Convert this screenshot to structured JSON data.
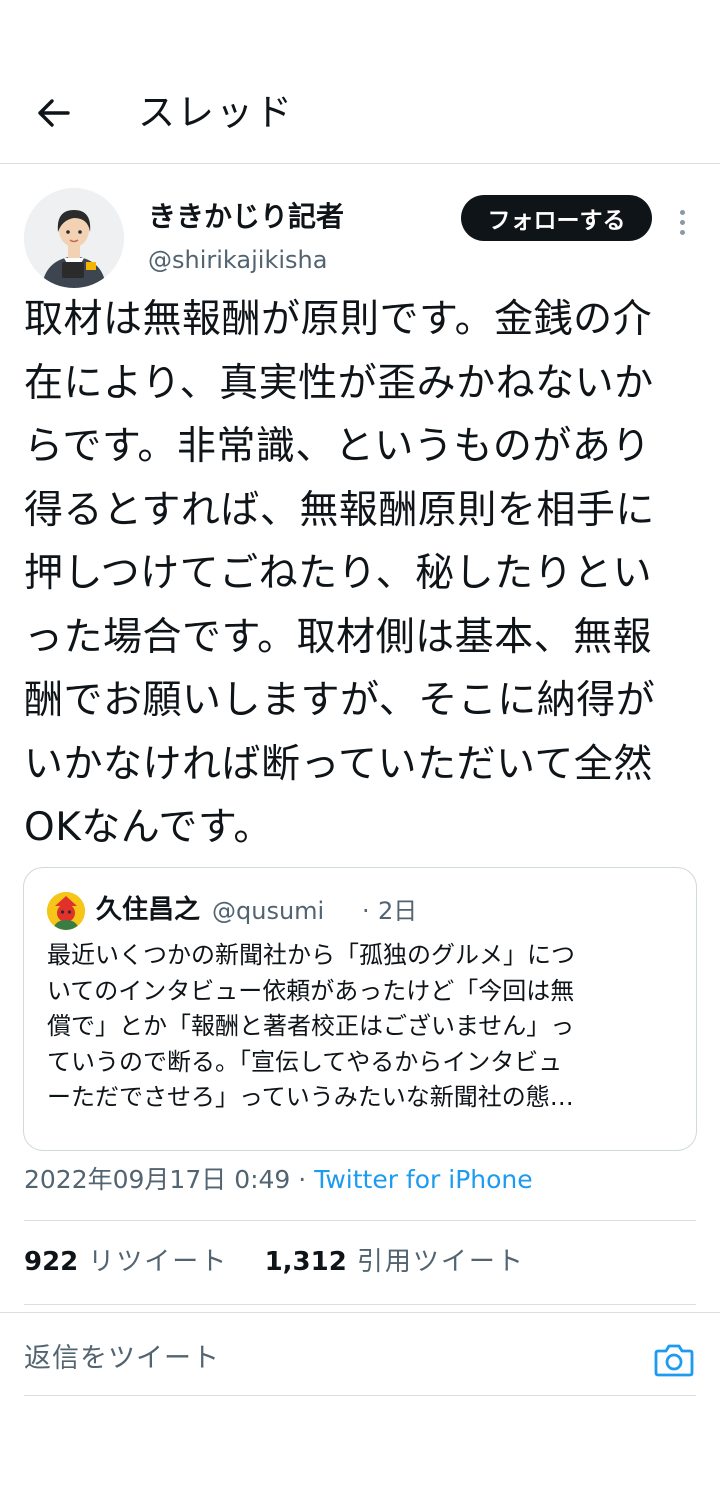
{
  "header": {
    "title": "スレッド",
    "back_icon": "arrow-left-icon"
  },
  "tweet": {
    "author": {
      "name": "ききかじり記者",
      "handle": "@shirikajikisha"
    },
    "follow_label": "フォローする",
    "more_icon": "more-vertical-icon",
    "text": "取材は無報酬が原則です。金銭の介\n在により、真実性が歪みかねないか\nらです。非常識、というものがあり\n得るとすれば、無報酬原則を相手に\n押しつけてごねたり、秘したりとい\nった場合です。取材側は基本、無報\n酬でお願いしますが、そこに納得が\nいかなければ断っていただいて全然\nOKなんです。",
    "quote": {
      "name": "久住昌之",
      "handle": "@qusumi",
      "separator": "·",
      "date": "2日",
      "text": "最近いくつかの新聞社から「孤独のグルメ」につ\nいてのインタビュー依頼があったけど「今回は無\n償で」とか「報酬と著者校正はございません」っ\nていうので断る。「宣伝してやるからインタビュ\nーただでさせろ」っていうみたいな新聞社の態…"
    },
    "timestamp": "2022年09月17日 0:49",
    "meta_separator": " · ",
    "source": "Twitter for iPhone",
    "stats": {
      "retweets_count": "922",
      "retweets_label": "リツイート",
      "quotes_count": "1,312",
      "quotes_label": "引用ツイート"
    }
  },
  "reply": {
    "placeholder": "返信をツイート",
    "camera_icon": "camera-icon"
  },
  "colors": {
    "text_primary": "#0f1419",
    "text_secondary": "#536471",
    "link": "#1d9bf0",
    "border": "#dcdfe2",
    "follow_bg": "#0f1419"
  }
}
